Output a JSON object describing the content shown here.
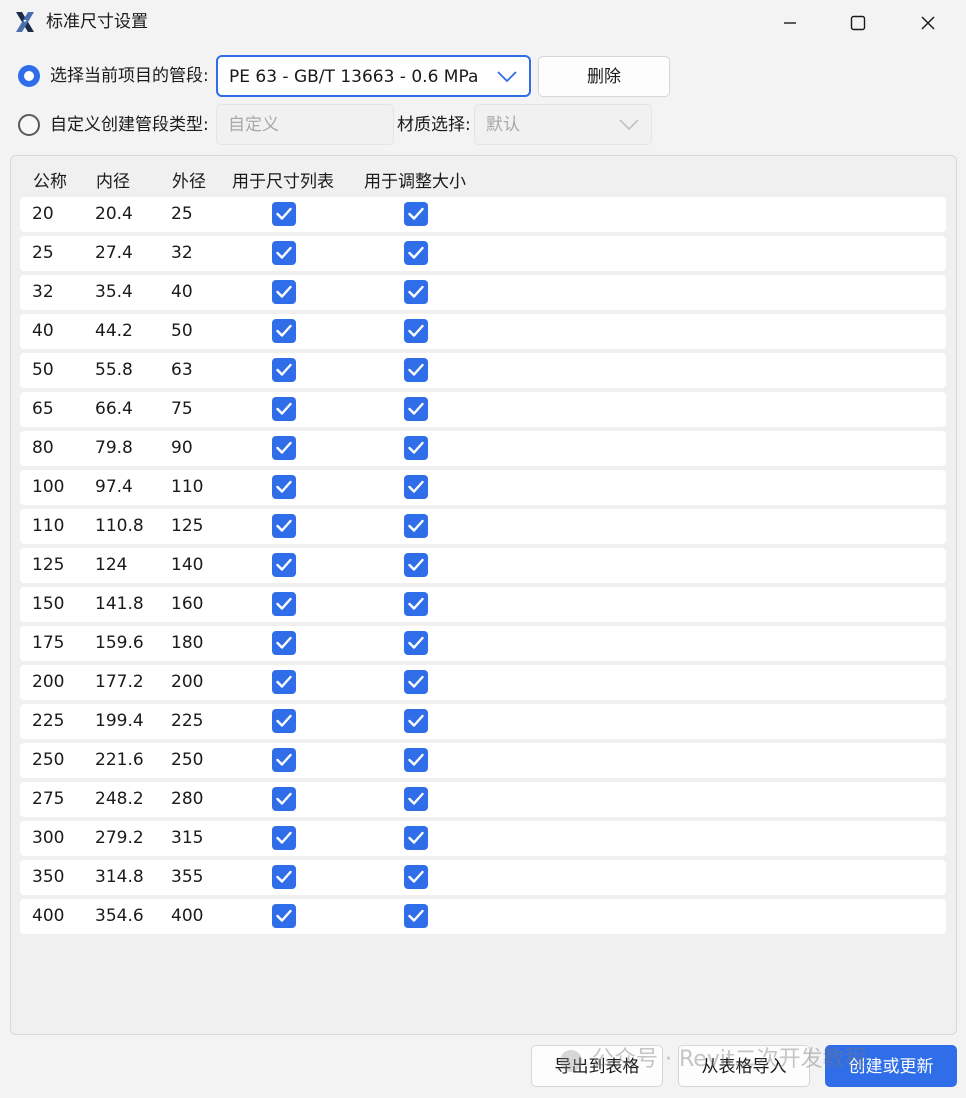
{
  "window": {
    "title": "标准尺寸设置",
    "icon": "x-logo-icon",
    "controls": [
      "minimize-icon",
      "maximize-icon",
      "close-icon"
    ]
  },
  "options": {
    "select_current": {
      "label": "选择当前项目的管段:",
      "checked": true,
      "selected_value": "PE 63 - GB/T 13663 - 0.6 MPa",
      "delete_label": "删除"
    },
    "custom": {
      "label": "自定义创建管段类型:",
      "checked": false,
      "placeholder": "自定义",
      "material_label": "材质选择:",
      "material_value": "默认"
    }
  },
  "table": {
    "headers": [
      "公称",
      "内径",
      "外径",
      "用于尺寸列表",
      "用于调整大小"
    ],
    "rows": [
      {
        "nominal": "20",
        "inner": "20.4",
        "outer": "25",
        "size_list": true,
        "resize": true
      },
      {
        "nominal": "25",
        "inner": "27.4",
        "outer": "32",
        "size_list": true,
        "resize": true
      },
      {
        "nominal": "32",
        "inner": "35.4",
        "outer": "40",
        "size_list": true,
        "resize": true
      },
      {
        "nominal": "40",
        "inner": "44.2",
        "outer": "50",
        "size_list": true,
        "resize": true
      },
      {
        "nominal": "50",
        "inner": "55.8",
        "outer": "63",
        "size_list": true,
        "resize": true
      },
      {
        "nominal": "65",
        "inner": "66.4",
        "outer": "75",
        "size_list": true,
        "resize": true
      },
      {
        "nominal": "80",
        "inner": "79.8",
        "outer": "90",
        "size_list": true,
        "resize": true
      },
      {
        "nominal": "100",
        "inner": "97.4",
        "outer": "110",
        "size_list": true,
        "resize": true
      },
      {
        "nominal": "110",
        "inner": "110.8",
        "outer": "125",
        "size_list": true,
        "resize": true
      },
      {
        "nominal": "125",
        "inner": "124",
        "outer": "140",
        "size_list": true,
        "resize": true
      },
      {
        "nominal": "150",
        "inner": "141.8",
        "outer": "160",
        "size_list": true,
        "resize": true
      },
      {
        "nominal": "175",
        "inner": "159.6",
        "outer": "180",
        "size_list": true,
        "resize": true
      },
      {
        "nominal": "200",
        "inner": "177.2",
        "outer": "200",
        "size_list": true,
        "resize": true
      },
      {
        "nominal": "225",
        "inner": "199.4",
        "outer": "225",
        "size_list": true,
        "resize": true
      },
      {
        "nominal": "250",
        "inner": "221.6",
        "outer": "250",
        "size_list": true,
        "resize": true
      },
      {
        "nominal": "275",
        "inner": "248.2",
        "outer": "280",
        "size_list": true,
        "resize": true
      },
      {
        "nominal": "300",
        "inner": "279.2",
        "outer": "315",
        "size_list": true,
        "resize": true
      },
      {
        "nominal": "350",
        "inner": "314.8",
        "outer": "355",
        "size_list": true,
        "resize": true
      },
      {
        "nominal": "400",
        "inner": "354.6",
        "outer": "400",
        "size_list": true,
        "resize": true
      }
    ]
  },
  "footer": {
    "export_label": "导出到表格",
    "import_label": "从表格导入",
    "create_label": "创建或更新"
  },
  "watermark": "公众号 · Revit二次开发教程",
  "colors": {
    "accent": "#2f6ee8",
    "window_bg": "#f3f3f3",
    "row_bg": "#ffffff",
    "disabled_text": "#a0a0a0"
  }
}
